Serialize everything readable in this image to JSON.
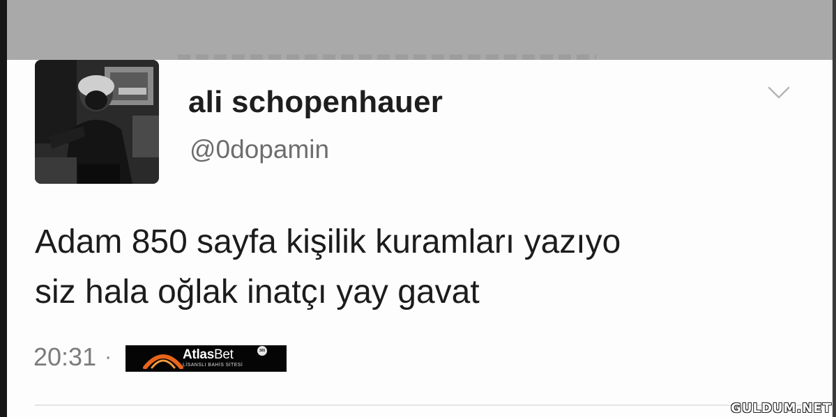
{
  "tweet": {
    "display_name": "ali schopenhauer",
    "handle": "@0dopamin",
    "text_lines": [
      "Adam 850 sayfa kişilik kuramları yazıyo",
      "siz hala oğlak inatçı yay gavat"
    ],
    "timestamp": "20:31",
    "separator": "·",
    "menu_icon": "chevron-down-icon"
  },
  "ad": {
    "brand_regular": "Atlas",
    "brand_light": "Bet",
    "badge": "365",
    "tagline": "LİSANSLI BAHİS SİTESİ"
  },
  "watermark": "GULDUM.NET",
  "colors": {
    "top_bar": "#a9a9a9",
    "background": "#fdfdfd",
    "name": "#1e1e1e",
    "secondary": "#6d6d6d",
    "ad_background": "#050505"
  }
}
